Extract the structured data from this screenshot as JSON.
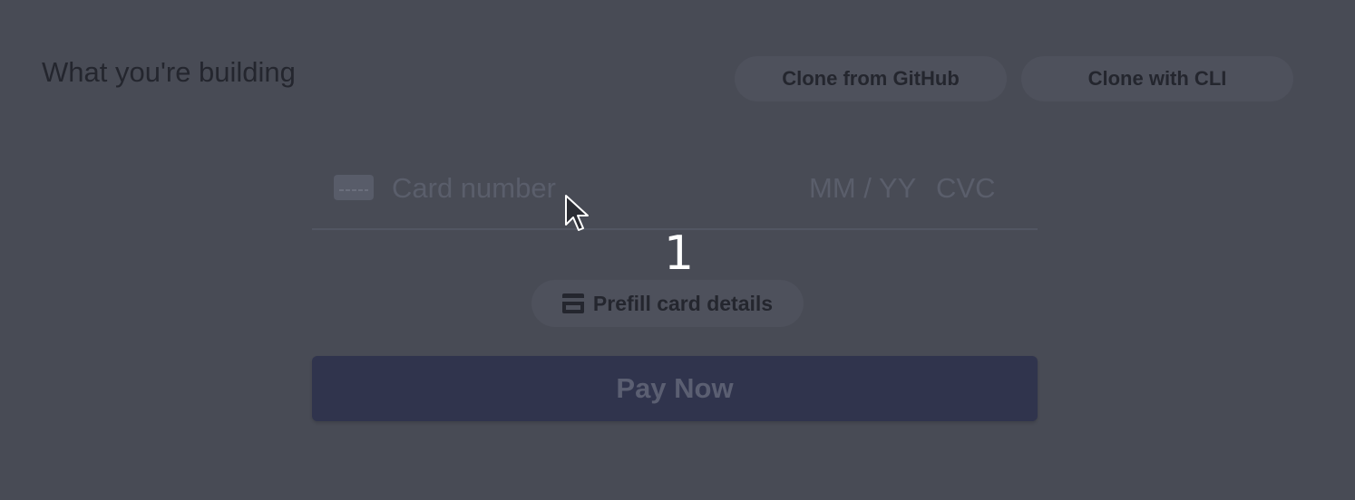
{
  "header": {
    "title": "What you're building"
  },
  "actions": {
    "clone_github": "Clone from GitHub",
    "clone_cli": "Clone with CLI"
  },
  "card_form": {
    "card_number_placeholder": "Card number",
    "expiry_placeholder": "MM / YY",
    "cvc_placeholder": "CVC",
    "card_icon": "credit-card-icon"
  },
  "overlay": {
    "step_number": "1",
    "cursor_icon": "mouse-pointer-icon"
  },
  "prefill": {
    "label": "Prefill card details",
    "icon": "credit-card-icon"
  },
  "pay": {
    "label": "Pay Now"
  },
  "colors": {
    "background": "#484b55",
    "pay_button": "#30344d",
    "pill_button": "#4e515c"
  }
}
